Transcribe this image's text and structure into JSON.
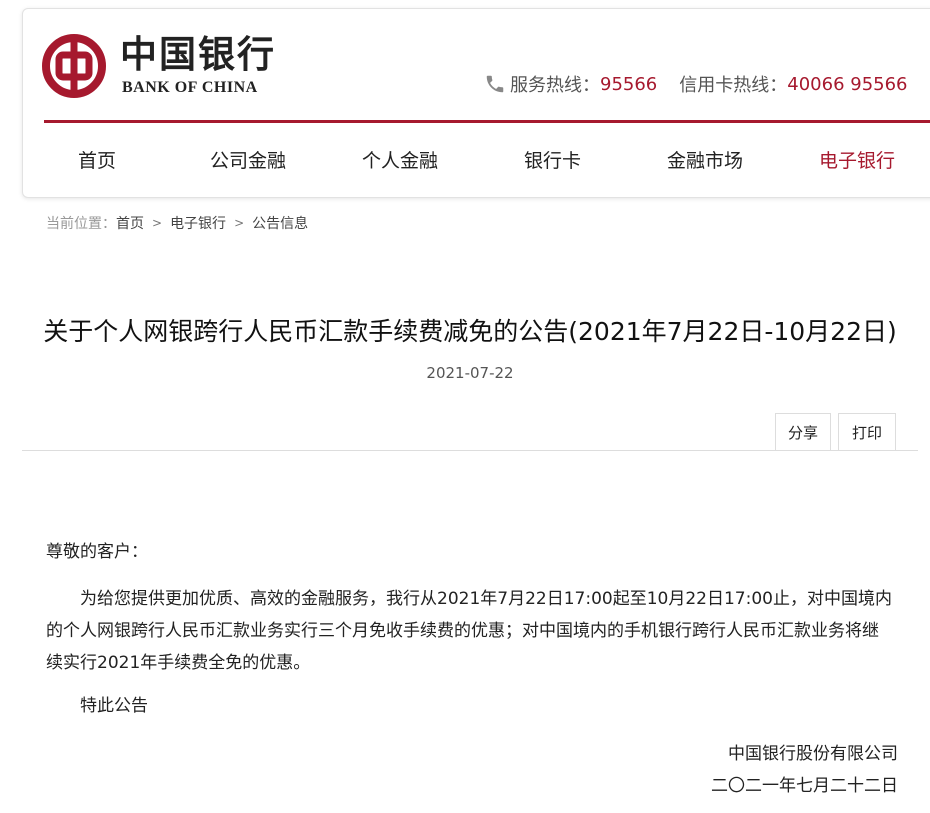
{
  "brand": {
    "name_cn": "中国银行",
    "name_en": "BANK OF CHINA",
    "color": "#a6192e"
  },
  "hotlines": {
    "icon": "phone-icon",
    "service_label": "服务热线：",
    "service_number": "95566",
    "card_label": "信用卡热线：",
    "card_number": "40066 95566"
  },
  "nav": {
    "items": [
      {
        "label": "首页",
        "active": false
      },
      {
        "label": "公司金融",
        "active": false
      },
      {
        "label": "个人金融",
        "active": false
      },
      {
        "label": "银行卡",
        "active": false
      },
      {
        "label": "金融市场",
        "active": false
      },
      {
        "label": "电子银行",
        "active": true
      }
    ]
  },
  "breadcrumb": {
    "prefix": "当前位置：",
    "items": [
      "首页",
      "电子银行",
      "公告信息"
    ]
  },
  "article": {
    "title": "关于个人网银跨行人民币汇款手续费减免的公告(2021年7月22日-10月22日)",
    "date": "2021-07-22",
    "share_label": "分享",
    "print_label": "打印",
    "greeting": "尊敬的客户：",
    "paragraph": "为给您提供更加优质、高效的金融服务，我行从2021年7月22日17:00起至10月22日17:00止，对中国境内的个人网银跨行人民币汇款业务实行三个月免收手续费的优惠；对中国境内的手机银行跨行人民币汇款业务将继续实行2021年手续费全免的优惠。",
    "closing": "特此公告",
    "signature_org": "中国银行股份有限公司",
    "signature_date": "二〇二一年七月二十二日"
  }
}
